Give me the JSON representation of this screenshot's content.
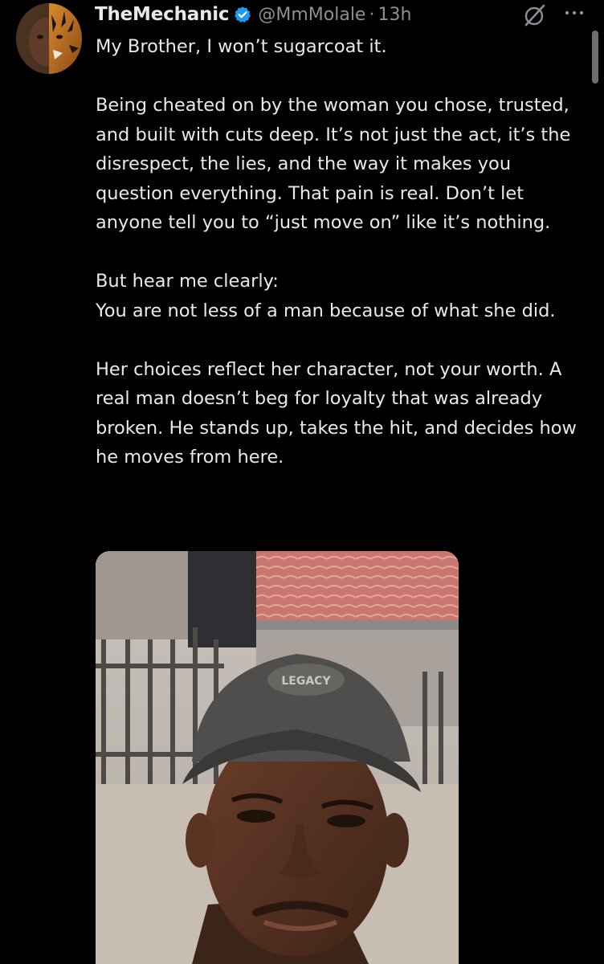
{
  "tweet": {
    "display_name": "TheMechanic",
    "handle": "@MmMolale",
    "separator": "·",
    "time": "13h",
    "paragraphs": [
      "My Brother, I won’t sugarcoat it.",
      "Being cheated on by the woman you chose, trusted, and built with cuts deep. It’s not just the act, it’s the disrespect, the lies, and the way it makes you question everything. That pain is real. Don’t let anyone tell you to “just move on” like it’s nothing.",
      "But hear me clearly:\nYou are not less of a man because of what she did.",
      "Her choices reflect her character, not your worth. A real man doesn’t beg for loyalty that was already broken. He stands up, takes the hit, and decides how he moves from here."
    ]
  },
  "icons": {
    "verified": "verified-badge-icon",
    "grok": "grok-icon",
    "more": "more-options-icon"
  },
  "colors": {
    "background": "#000000",
    "text": "#e7e9ea",
    "secondary_text": "#8b9096",
    "verified_blue": "#1d9bf0"
  }
}
